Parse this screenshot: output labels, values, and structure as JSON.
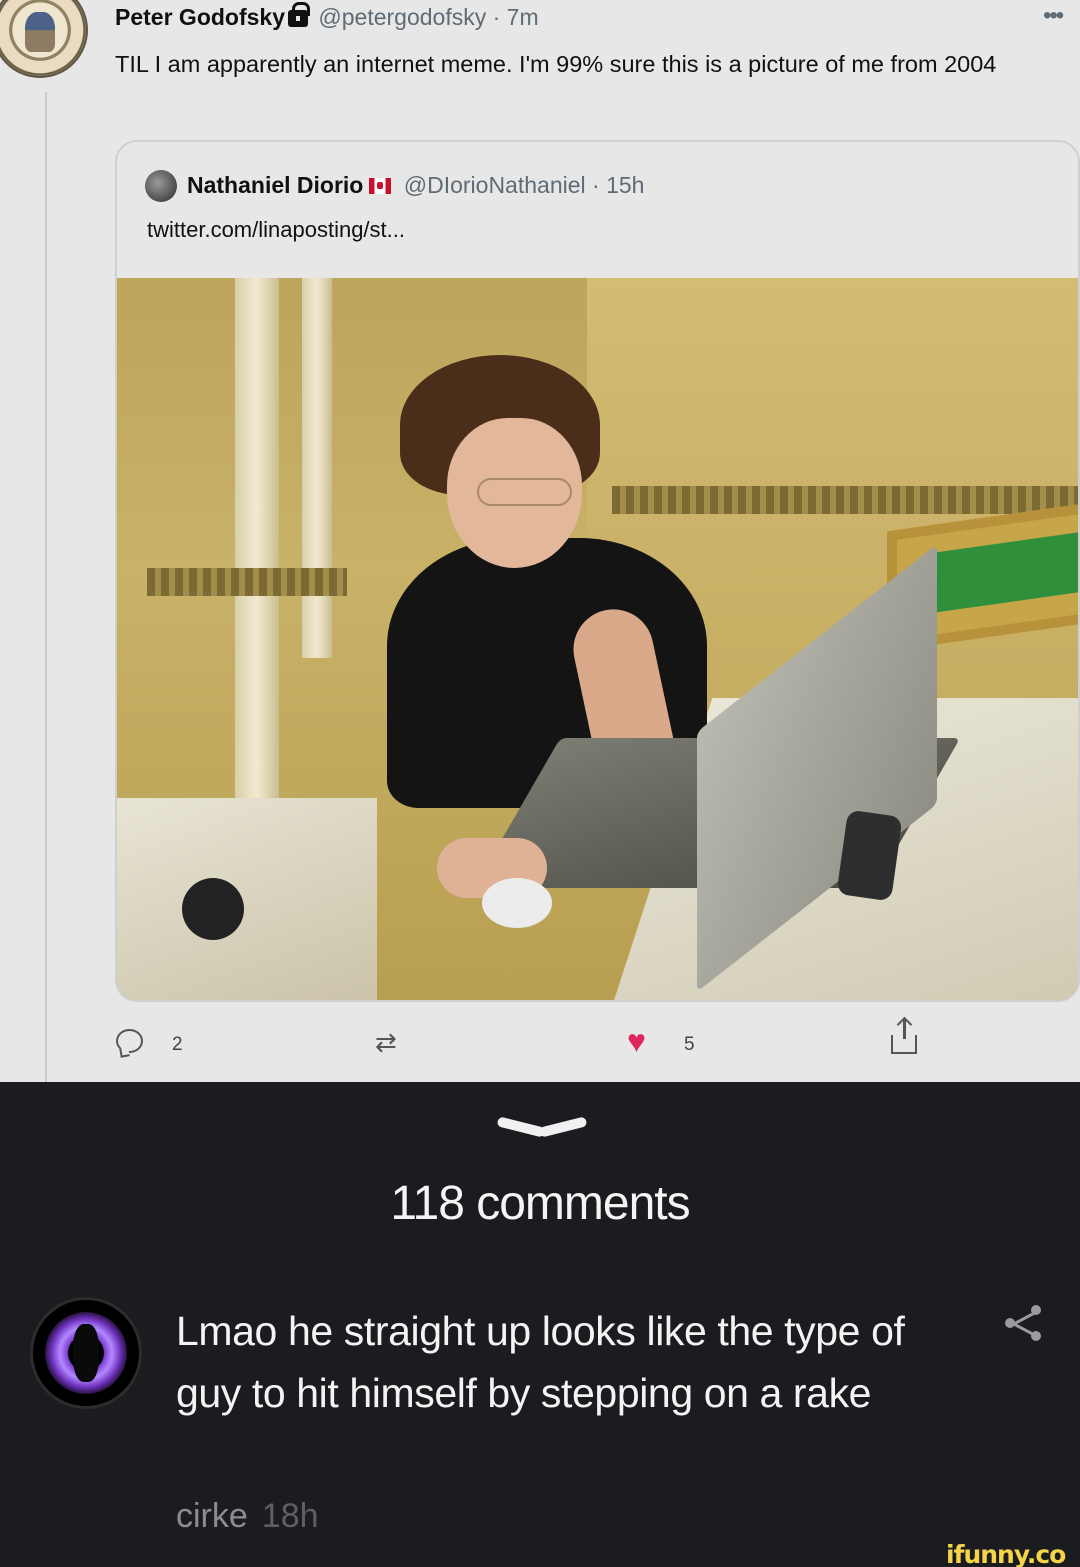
{
  "tweet": {
    "author_name": "Peter Godofsky",
    "author_handle": "@petergodofsky",
    "separator": "·",
    "time": "7m",
    "more": "•••",
    "text": "TIL I am apparently an internet meme. I'm 99% sure this is a picture of me from 2004",
    "quote": {
      "author_name": "Nathaniel Diorio",
      "author_handle": "@DIorioNathaniel",
      "separator": "·",
      "time": "15h",
      "link_text": "twitter.com/linaposting/st..."
    },
    "actions": {
      "reply_count": "2",
      "like_count": "5"
    }
  },
  "comments_section": {
    "count_label": "118 comments",
    "comment": {
      "text": "Lmao he straight up looks like the type of guy to hit himself by stepping on a rake",
      "username": "cirke",
      "time": "18h"
    }
  },
  "watermark": "ifunny.co",
  "colors": {
    "tweet_background": "#e7e7e7",
    "app_background": "#1b1c20",
    "like_heart": "#e0245e",
    "watermark": "#f5d547"
  },
  "icons": [
    "lock-icon",
    "more-icon",
    "canada-flag-icon",
    "reply-icon",
    "retweet-icon",
    "like-icon",
    "share-icon",
    "collapse-chevron-icon",
    "comment-share-icon"
  ]
}
